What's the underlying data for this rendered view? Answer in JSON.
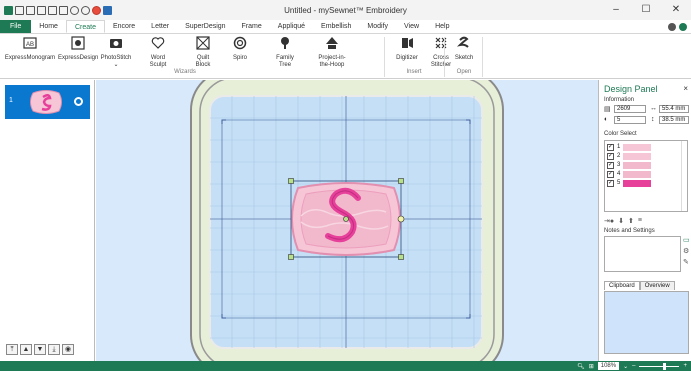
{
  "app": {
    "title": "Untitled - mySewnet™ Embroidery",
    "window_controls": [
      "–",
      "☐",
      "✕"
    ]
  },
  "tabs": [
    {
      "label": "File"
    },
    {
      "label": "Home"
    },
    {
      "label": "Create"
    },
    {
      "label": "Encore"
    },
    {
      "label": "Letter"
    },
    {
      "label": "SuperDesign"
    },
    {
      "label": "Frame"
    },
    {
      "label": "Appliqué"
    },
    {
      "label": "Embellish"
    },
    {
      "label": "Modify"
    },
    {
      "label": "View"
    },
    {
      "label": "Help"
    }
  ],
  "ribbon": {
    "buttons": {
      "express_monogram": "ExpressMonogram",
      "express_design": "ExpressDesign",
      "photostitch": "PhotoStitch",
      "word_sculpt": "Word\nSculpt",
      "quilt_block": "Quilt\nBlock",
      "spiro": "Spiro",
      "family_tree": "Family\nTree",
      "project_in_the_hoop": "Project-in-\nthe-Hoop",
      "digitizer": "Digitizer",
      "cross_stitcher": "Cross\nStitcher",
      "sketch": "Sketch"
    },
    "groups": {
      "wizards": "Wizards",
      "insert": "Insert",
      "open": "Open"
    }
  },
  "design_list": {
    "items": [
      {
        "number": "1"
      }
    ]
  },
  "design_panel": {
    "title": "Design Panel",
    "close": "×",
    "information_label": "Information",
    "stitches": "2609",
    "width": "55.4 mm",
    "colors": "5",
    "height": "38.5 mm",
    "color_select_label": "Color Select",
    "color_rows": [
      {
        "number": "1",
        "color": "#f7c6d6"
      },
      {
        "number": "2",
        "color": "#f7c6d6"
      },
      {
        "number": "3",
        "color": "#f2b8cc"
      },
      {
        "number": "4",
        "color": "#f2b8cc"
      },
      {
        "number": "5",
        "color": "#e6409a"
      }
    ],
    "notes_label": "Notes and Settings",
    "tabs": [
      "Clipboard",
      "Overview"
    ]
  },
  "status": {
    "zoom": "108%"
  },
  "colors": {
    "accent": "#1e7a55",
    "canvas_bg": "#d7e9fb",
    "hoop_fill": "#e7efd9",
    "design_pink": "#f7c6d6",
    "design_magenta": "#e6409a"
  }
}
